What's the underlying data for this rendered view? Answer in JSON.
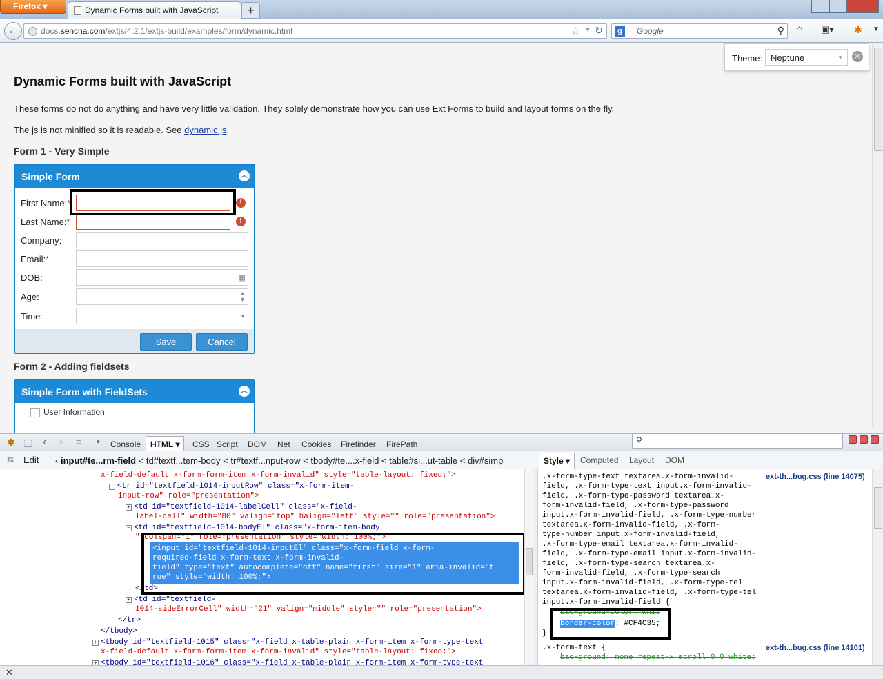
{
  "browser": {
    "menu_label": "Firefox",
    "tab_title": "Dynamic Forms built with JavaScript",
    "new_tab": "+",
    "url_domain_prefix": "docs.",
    "url_domain": "sencha.com",
    "url_path": "/extjs/4.2.1/extjs-build/examples/form/dynamic.html",
    "search_placeholder": "Google"
  },
  "theme": {
    "label": "Theme:",
    "value": "Neptune"
  },
  "page": {
    "title": "Dynamic Forms built with JavaScript",
    "intro": "These forms do not do anything and have very little validation. They solely demonstrate how you can use Ext Forms to build and layout forms on the fly.",
    "js_note_prefix": "The js is not minified so it is readable. See ",
    "js_link": "dynamic.js",
    "js_note_suffix": ".",
    "form1_heading": "Form 1 - Very Simple",
    "form2_heading": "Form 2 - Adding fieldsets"
  },
  "form1": {
    "title": "Simple Form",
    "fields": [
      {
        "label": "First Name:",
        "required": true,
        "invalid": true
      },
      {
        "label": "Last Name:",
        "required": true,
        "invalid": true
      },
      {
        "label": "Company:",
        "required": false,
        "invalid": false
      },
      {
        "label": "Email:",
        "required": true,
        "invalid": false
      },
      {
        "label": "DOB:",
        "required": false,
        "invalid": false
      },
      {
        "label": "Age:",
        "required": false,
        "invalid": false
      },
      {
        "label": "Time:",
        "required": false,
        "invalid": false
      }
    ],
    "save": "Save",
    "cancel": "Cancel"
  },
  "form2": {
    "title": "Simple Form with FieldSets",
    "fieldset": "User Information"
  },
  "firebug": {
    "tabs": [
      "Console",
      "HTML",
      "CSS",
      "Script",
      "DOM",
      "Net",
      "Cookies",
      "Firefinder",
      "FirePath"
    ],
    "active_tab": "HTML",
    "edit": "Edit",
    "crumb_active": "input#te...rm-field",
    "crumbs": [
      "td#textf...tem-body",
      "tr#textf...nput-row",
      "tbody#te....x-field",
      "table#si...ut-table",
      "div#simp"
    ],
    "style_tabs": [
      "Style",
      "Computed",
      "Layout",
      "DOM"
    ],
    "html_lines": [
      "x-field-default x-form-form-item x-form-invalid\" style=\"table-layout: fixed;\">",
      "<tr id=\"textfield-1014-inputRow\" class=\"x-form-item-",
      "input-row\" role=\"presentation\">",
      "<td id=\"textfield-1014-labelCell\" class=\"x-field-",
      "label-cell\" width=\"80\" valign=\"top\" halign=\"left\" style=\"\" role=\"presentation\">",
      "<td id=\"textfield-1014-bodyEl\" class=\"x-form-item-body",
      "\" colspan=\"1\" role=\"presentation\" style=\"width: 100%;\">",
      "<input id=\"textfield-1014-inputEl\" class=\"x-form-field x-form-",
      "required-field x-form-text x-form-invalid-",
      "field\" type=\"text\" autocomplete=\"off\" name=\"first\" size=\"1\" aria-invalid=\"t",
      "rue\" style=\"width: 100%;\">",
      "</td>",
      "<td id=\"textfield-",
      "1014-sideErrorCell\" width=\"21\" valign=\"middle\" style=\"\" role=\"presentation\">",
      "</tr>",
      "</tbody>",
      "<tbody id=\"textfield-1015\" class=\"x-field x-table-plain x-form-item x-form-type-text",
      "x-field-default x-form-form-item x-form-invalid\" style=\"table-layout: fixed;\">",
      "<tbody id=\"textfield-1016\" class=\"x-field x-table-plain x-form-item x-form-type-text"
    ],
    "style_selector": ".x-form-type-text textarea.x-form-invalid-\nfield, .x-form-type-text input.x-form-invalid-\nfield, .x-form-type-password textarea.x-\nform-invalid-field, .x-form-type-password\ninput.x-form-invalid-field, .x-form-type-number\ntextarea.x-form-invalid-field, .x-form-\ntype-number input.x-form-invalid-field,\n.x-form-type-email textarea.x-form-invalid-\nfield, .x-form-type-email input.x-form-invalid-\nfield, .x-form-type-search textarea.x-\nform-invalid-field, .x-form-type-search\ninput.x-form-invalid-field, .x-form-type-tel\ntextarea.x-form-invalid-field, .x-form-type-tel\ninput.x-form-invalid-field {",
    "style_source_1": "ext-th...bug.css (line 14075)",
    "prop1": "background-color: whit",
    "prop2_name": "border-color",
    "prop2_value": ": #CF4C35;",
    "close_brace": "}",
    "rule2_selector": ".x-form-text {",
    "style_source_2": "ext-th...bug.css (line 14101)",
    "rule2_prop": "background: none repeat-x scroll 0 0 white;"
  },
  "colors": {
    "accent": "#157fcc",
    "invalid": "#CF4C35",
    "highlight": "#3b8fe8"
  }
}
